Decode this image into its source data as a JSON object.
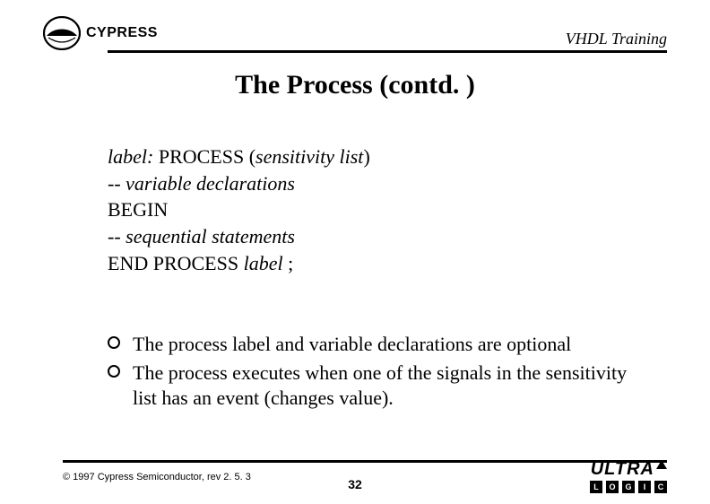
{
  "header": {
    "brand": "CYPRESS",
    "label": "VHDL Training"
  },
  "title": "The Process (contd. )",
  "code": {
    "l1a": "label:",
    "l1b": " PROCESS (",
    "l1c": "sensitivity list",
    "l1d": ")",
    "l2a": "-- ",
    "l2b": "variable declarations",
    "l3": "BEGIN",
    "l4a": "-- ",
    "l4b": "sequential statements",
    "l5a": "END PROCESS ",
    "l5b": "label",
    "l5c": " ;"
  },
  "bullets": [
    "The process label and variable declarations are optional",
    "The process executes when one of the signals in the sensitivity list has an event (changes value)."
  ],
  "footer": {
    "copyright": "© 1997 Cypress Semiconductor, rev 2. 5. 3",
    "page": "32",
    "ultra": "ULTRA",
    "ultra_boxes": [
      "L",
      "O",
      "G",
      "I",
      "C"
    ]
  }
}
